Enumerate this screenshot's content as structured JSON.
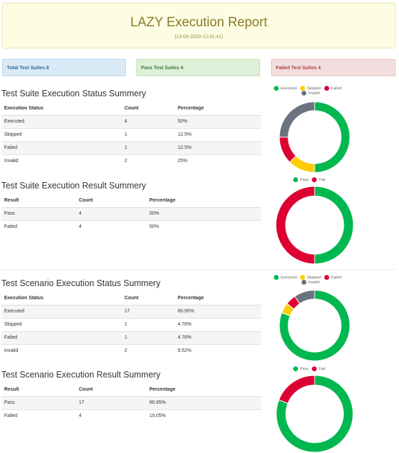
{
  "header": {
    "title": "LAZY Execution Report",
    "subtitle": "(13-04-2020-12:41:41)"
  },
  "stats": {
    "total": "Total Test Suites 8",
    "pass": "Pass Test Suites 4",
    "failed": "Failed Test Suites 4"
  },
  "colors": {
    "executed": "#00b84f",
    "skipped": "#ffcc00",
    "failed": "#dd0033",
    "invalid": "#6b7280",
    "pass": "#00b84f",
    "fail": "#dd0033"
  },
  "sections": [
    {
      "title": "Test Suite Execution Status Summery",
      "headers": [
        "Execution Status",
        "Count",
        "Percentage"
      ],
      "rows": [
        [
          "Executed",
          "4",
          "50%"
        ],
        [
          "Skipped",
          "1",
          "12.5%"
        ],
        [
          "Failed",
          "1",
          "12.5%"
        ],
        [
          "Invalid",
          "2",
          "25%"
        ]
      ]
    },
    {
      "title": "Test Suite Execution Result Summery",
      "headers": [
        "Result",
        "Count",
        "Percentage"
      ],
      "rows": [
        [
          "Pass",
          "4",
          "50%"
        ],
        [
          "Failed",
          "4",
          "50%"
        ]
      ]
    },
    {
      "title": "Test Scenario Execution Status Summery",
      "headers": [
        "Execution Status",
        "Count",
        "Percentage"
      ],
      "rows": [
        [
          "Executed",
          "17",
          "80.95%"
        ],
        [
          "Skipped",
          "1",
          "4.76%"
        ],
        [
          "Failed",
          "1",
          "4.76%"
        ],
        [
          "Invalid",
          "2",
          "9.52%"
        ]
      ]
    },
    {
      "title": "Test Scenario Execution Result Summery",
      "headers": [
        "Result",
        "Count",
        "Percentage"
      ],
      "rows": [
        [
          "Pass",
          "17",
          "80.95%"
        ],
        [
          "Failed",
          "4",
          "19.05%"
        ]
      ]
    }
  ],
  "chart_data": [
    {
      "type": "pie",
      "labels": [
        "Executed",
        "Skipped",
        "Failed",
        "Invalid"
      ],
      "values": [
        4,
        1,
        1,
        2
      ],
      "colors": [
        "#00b84f",
        "#ffcc00",
        "#dd0033",
        "#6b7280"
      ],
      "legend": "top"
    },
    {
      "type": "pie",
      "labels": [
        "Pass",
        "Fail"
      ],
      "values": [
        4,
        4
      ],
      "colors": [
        "#00b84f",
        "#dd0033"
      ],
      "legend": "top"
    },
    {
      "type": "pie",
      "labels": [
        "Executed",
        "Skipped",
        "Failed",
        "Invalid"
      ],
      "values": [
        17,
        1,
        1,
        2
      ],
      "colors": [
        "#00b84f",
        "#ffcc00",
        "#dd0033",
        "#6b7280"
      ],
      "legend": "top"
    },
    {
      "type": "pie",
      "labels": [
        "Pass",
        "Fail"
      ],
      "values": [
        17,
        4
      ],
      "colors": [
        "#00b84f",
        "#dd0033"
      ],
      "legend": "top"
    }
  ]
}
